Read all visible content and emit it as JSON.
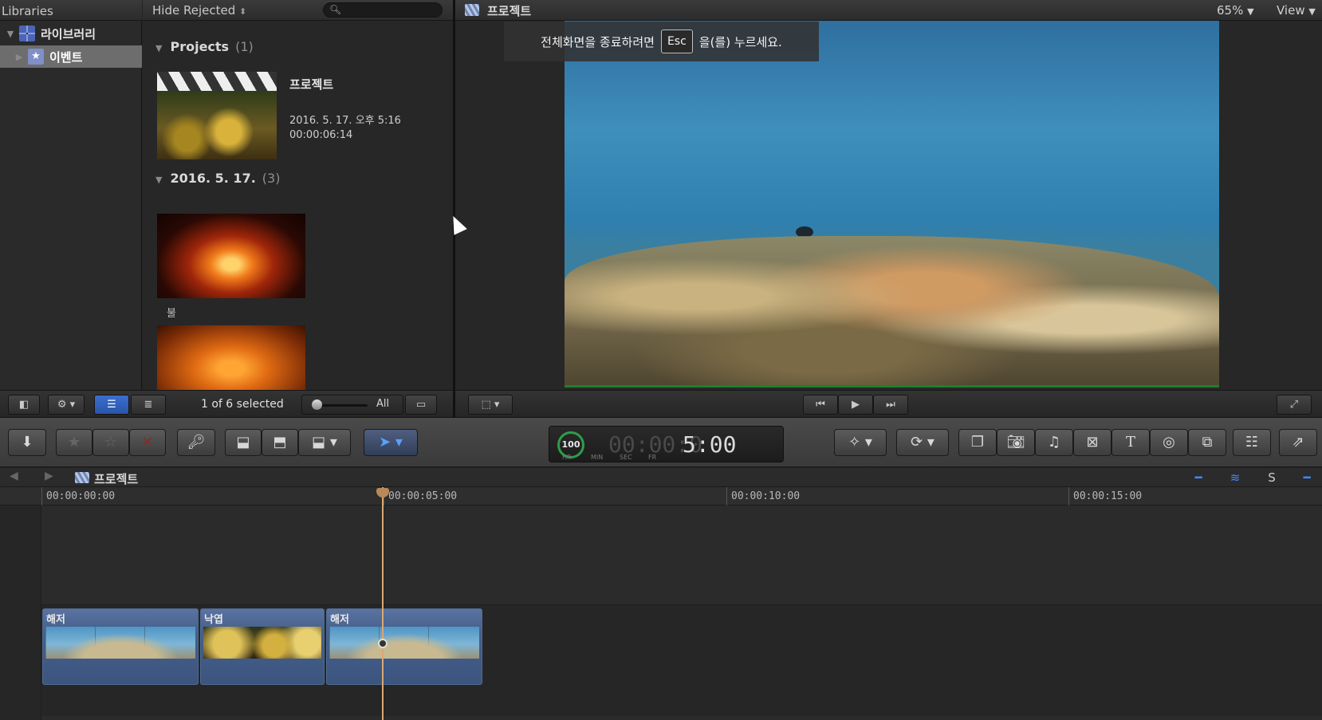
{
  "libraries_header": "Libraries",
  "sidebar": {
    "items": [
      {
        "label": "라이브러리",
        "icon": "library-grid-icon"
      },
      {
        "label": "이벤트",
        "icon": "star-event-icon"
      }
    ]
  },
  "browser": {
    "filter": "Hide Rejected",
    "search_placeholder": "",
    "groups": [
      {
        "title": "Projects",
        "count": "(1)"
      },
      {
        "title": "2016. 5. 17.",
        "count": "(3)"
      }
    ],
    "project": {
      "name": "프로젝트",
      "date": "2016. 5. 17. 오후 5:16",
      "duration": "00:00:06:14"
    },
    "clips": [
      {
        "label": "불"
      }
    ],
    "footer": {
      "selection": "1 of 6 selected",
      "zoom_label": "All"
    }
  },
  "viewer": {
    "title": "프로젝트",
    "zoom": "65%",
    "view": "View",
    "fullscreen_banner": {
      "before": "전체화면을 종료하려면",
      "key": "Esc",
      "after": "을(를) 누르세요."
    }
  },
  "timecode": {
    "percent": "100",
    "dim_part": "00:00:0",
    "value": "5:00",
    "units": [
      "HR",
      "MIN",
      "SEC",
      "FR"
    ]
  },
  "timeline": {
    "title": "프로젝트",
    "ruler": [
      "00:00:00:00",
      "00:00:05:00",
      "00:00:10:00",
      "00:00:15:00"
    ],
    "clips": [
      {
        "label": "해저",
        "kind": "ocean"
      },
      {
        "label": "낙엽",
        "kind": "leaf"
      },
      {
        "label": "해저",
        "kind": "ocean"
      }
    ]
  },
  "colors": {
    "accent": "#3d8bff",
    "playhead": "#d9a874",
    "clip": "#46608c"
  }
}
